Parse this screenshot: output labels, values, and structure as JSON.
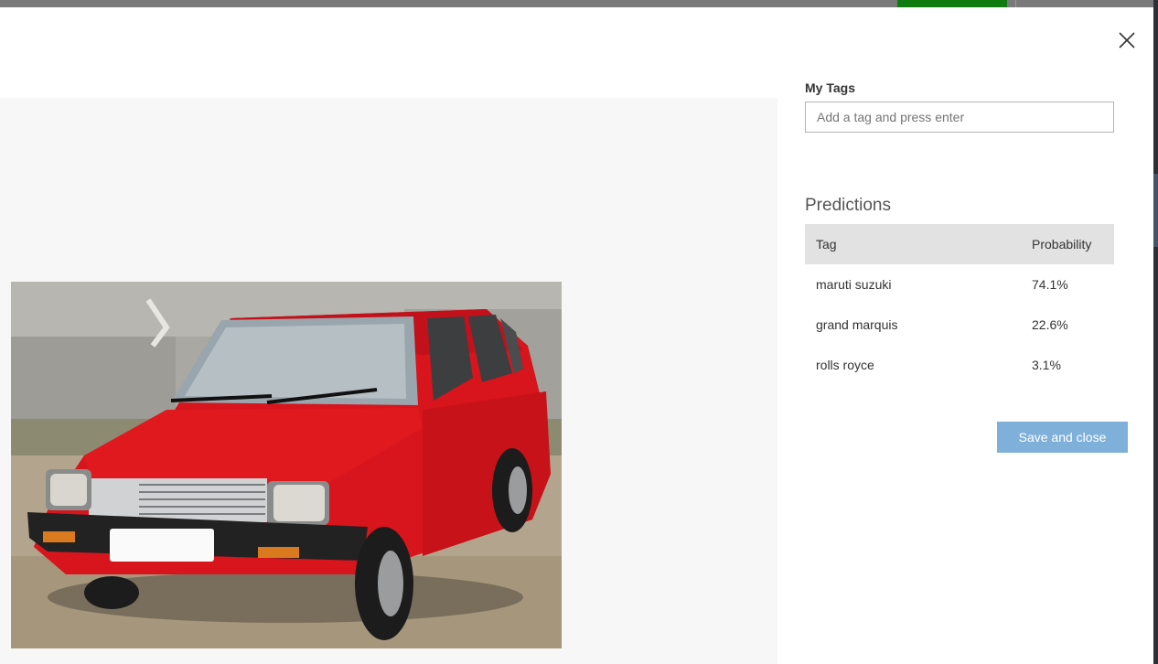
{
  "dialog": {
    "close_label": "Close"
  },
  "my_tags": {
    "label": "My Tags",
    "placeholder": "Add a tag and press enter"
  },
  "predictions": {
    "title": "Predictions",
    "columns": [
      "Tag",
      "Probability"
    ],
    "rows": [
      {
        "tag": "maruti suzuki",
        "probability": "74.1%"
      },
      {
        "tag": "grand marquis",
        "probability": "22.6%"
      },
      {
        "tag": "rolls royce",
        "probability": "3.1%"
      }
    ]
  },
  "actions": {
    "save_label": "Save and close"
  },
  "colors": {
    "save_button": "#7fb0d9",
    "table_header": "#e2e2e2",
    "preview_bg": "#f7f7f7"
  }
}
